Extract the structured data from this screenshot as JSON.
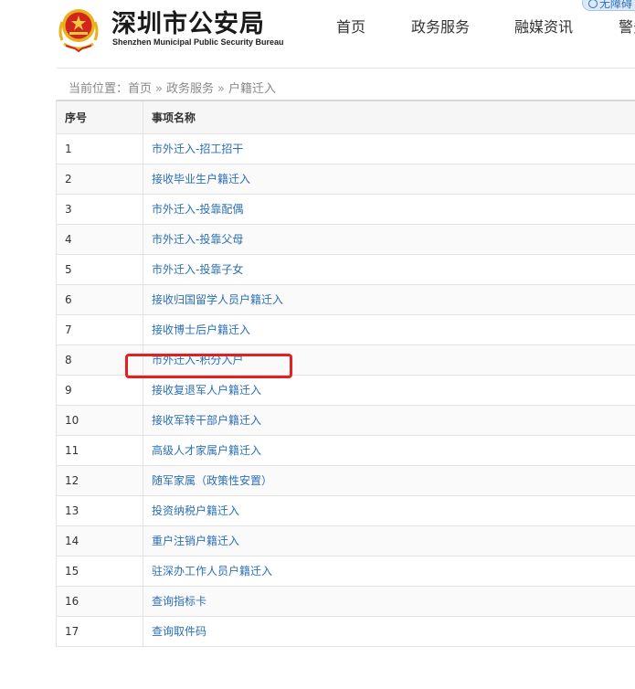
{
  "header": {
    "title_cn": "深圳市公安局",
    "title_en": "Shenzhen Municipal Public Security Bureau",
    "nav": [
      {
        "label": "首页"
      },
      {
        "label": "政务服务"
      },
      {
        "label": "融媒资讯"
      },
      {
        "label": "警务"
      }
    ],
    "accessibility_label": "无障碍"
  },
  "breadcrumb": {
    "prefix": "当前位置：",
    "items": [
      "首页",
      "政务服务",
      "户籍迁入"
    ],
    "separator": "»"
  },
  "table": {
    "headers": [
      "序号",
      "事项名称"
    ],
    "rows": [
      {
        "num": "1",
        "name": "市外迁入-招工招干"
      },
      {
        "num": "2",
        "name": "接收毕业生户籍迁入"
      },
      {
        "num": "3",
        "name": "市外迁入-投靠配偶"
      },
      {
        "num": "4",
        "name": "市外迁入-投靠父母"
      },
      {
        "num": "5",
        "name": "市外迁入-投靠子女"
      },
      {
        "num": "6",
        "name": "接收归国留学人员户籍迁入"
      },
      {
        "num": "7",
        "name": "接收博士后户籍迁入"
      },
      {
        "num": "8",
        "name": "市外迁入-积分入户"
      },
      {
        "num": "9",
        "name": "接收复退军人户籍迁入"
      },
      {
        "num": "10",
        "name": "接收军转干部户籍迁入"
      },
      {
        "num": "11",
        "name": "高级人才家属户籍迁入"
      },
      {
        "num": "12",
        "name": "随军家属（政策性安置）"
      },
      {
        "num": "13",
        "name": "投资纳税户籍迁入"
      },
      {
        "num": "14",
        "name": "重户注销户籍迁入"
      },
      {
        "num": "15",
        "name": "驻深办工作人员户籍迁入"
      },
      {
        "num": "16",
        "name": "查询指标卡"
      },
      {
        "num": "17",
        "name": "查询取件码"
      }
    ]
  },
  "colors": {
    "link": "#2a6fb6",
    "highlight": "#e51f1f",
    "emblem_red": "#d0261d",
    "emblem_gold": "#e8b21c"
  }
}
